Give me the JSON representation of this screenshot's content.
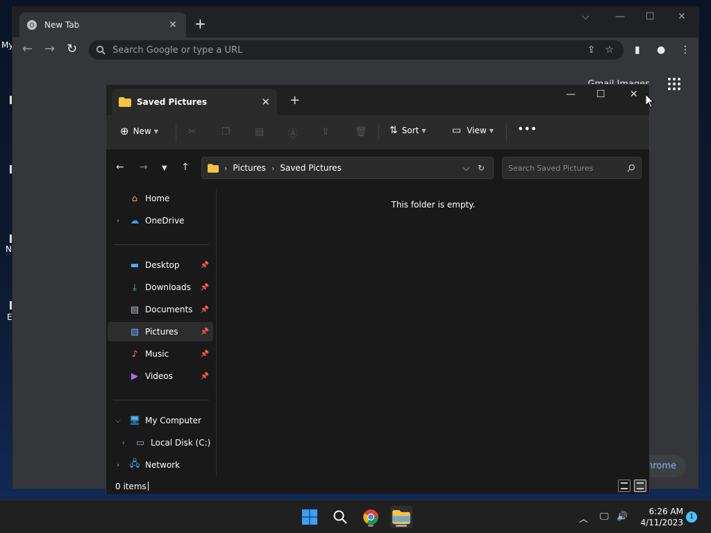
{
  "desktop": {
    "icon_labels": [
      "My",
      "N",
      "E"
    ]
  },
  "chrome": {
    "tab_title": "New Tab",
    "omnibox_placeholder": "Search Google or type a URL",
    "header_links": "Gmail   Images",
    "customize_label": "hrome"
  },
  "explorer": {
    "tab_title": "Saved Pictures",
    "commands": {
      "new": "New",
      "sort": "Sort",
      "view": "View"
    },
    "breadcrumb": [
      "Pictures",
      "Saved Pictures"
    ],
    "search_placeholder": "Search Saved Pictures",
    "nav": {
      "home": "Home",
      "onedrive": "OneDrive",
      "desktop": "Desktop",
      "downloads": "Downloads",
      "documents": "Documents",
      "pictures": "Pictures",
      "music": "Music",
      "videos": "Videos",
      "my_computer": "My Computer",
      "local_disk": "Local Disk (C:)",
      "network": "Network"
    },
    "empty_message": "This folder is empty.",
    "status_count": "0 items"
  },
  "taskbar": {
    "time": "6:26 AM",
    "date": "4/11/2023",
    "notification_count": "1"
  },
  "colors": {
    "explorer_bg": "#191919",
    "chrome_bg": "#35363a",
    "accent": "#4cc2ff",
    "folder_yellow": "#f6c342"
  }
}
